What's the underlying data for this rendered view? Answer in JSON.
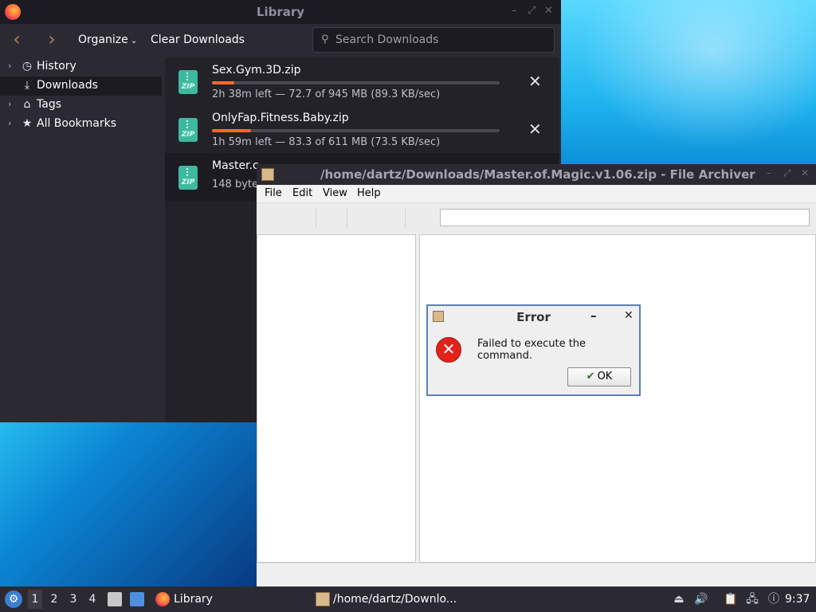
{
  "library": {
    "title": "Library",
    "toolbar": {
      "organize": "Organize",
      "clear_downloads": "Clear Downloads",
      "search_placeholder": "Search Downloads"
    },
    "sidebar": [
      {
        "label": "History",
        "icon": "clock-icon"
      },
      {
        "label": "Downloads",
        "icon": "download-icon",
        "selected": true
      },
      {
        "label": "Tags",
        "icon": "tag-icon"
      },
      {
        "label": "All Bookmarks",
        "icon": "star-icon"
      }
    ],
    "downloads": [
      {
        "name": "Sex.Gym.3D.zip",
        "status": "2h 38m left — 72.7 of 945 MB (89.3 KB/sec)",
        "progress": 0.077
      },
      {
        "name": "OnlyFap.Fitness.Baby.zip",
        "status": "1h 59m left — 83.3 of 611 MB (73.5 KB/sec)",
        "progress": 0.136
      },
      {
        "name": "Master.c",
        "status": "148 byte"
      }
    ]
  },
  "archiver": {
    "title": "/home/dartz/Downloads/Master.of.Magic.v1.06.zip - File Archiver",
    "menu": {
      "file": "File",
      "edit": "Edit",
      "view": "View",
      "help": "Help"
    }
  },
  "error_dialog": {
    "title": "Error",
    "message": "Failed to execute the command.",
    "ok_label": "OK"
  },
  "taskbar": {
    "workspaces": [
      "1",
      "2",
      "3",
      "4"
    ],
    "tasks": {
      "library": "Library",
      "archiver": "/home/dartz/Downlo..."
    },
    "clock": "9:37"
  },
  "zip_label": "ZIP"
}
